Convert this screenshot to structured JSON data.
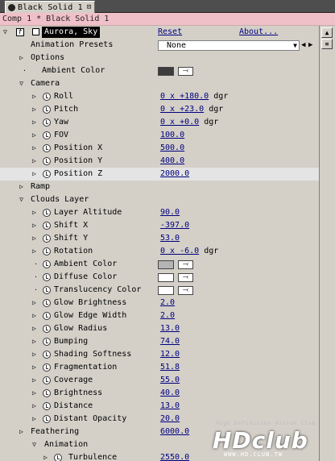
{
  "tab": {
    "label": "Black Solid 1",
    "pin": "⊡"
  },
  "comp_label": "Comp 1 * Black Solid 1",
  "effect": {
    "name": "Aurora, Sky",
    "reset_label": "Reset",
    "about_label": "About..."
  },
  "presets": {
    "label": "Animation Presets",
    "value": "None"
  },
  "colors": {
    "ambient_top": "#3c3c3c",
    "ambient_clouds": "#b4b4b4",
    "diffuse": "#ffffff",
    "translucency": "#ffffff",
    "panel_bg": "#d4d0c8",
    "value_blue": "#000080"
  },
  "rows": [
    {
      "kind": "group",
      "indent": 0,
      "open": false,
      "label": "Options"
    },
    {
      "kind": "color",
      "indent": 0,
      "label": "Ambient Color",
      "color": "#3c3c3c"
    },
    {
      "kind": "group",
      "indent": 0,
      "open": true,
      "label": "Camera"
    },
    {
      "kind": "prop",
      "label": "Roll",
      "num": "0 x +180.0",
      "unit": " dgr"
    },
    {
      "kind": "prop",
      "label": "Pitch",
      "num": "0 x +23.0",
      "unit": " dgr"
    },
    {
      "kind": "prop",
      "label": "Yaw",
      "num": "0 x +0.0",
      "unit": " dgr"
    },
    {
      "kind": "prop",
      "label": "FOV",
      "num": "100.0",
      "unit": ""
    },
    {
      "kind": "prop",
      "label": "Position X",
      "num": "500.0",
      "unit": ""
    },
    {
      "kind": "prop",
      "label": "Position Y",
      "num": "400.0",
      "unit": ""
    },
    {
      "kind": "prop",
      "label": "Position Z",
      "num": "2000.0",
      "unit": "",
      "highlight": true
    },
    {
      "kind": "group",
      "indent": 0,
      "open": false,
      "label": "Ramp"
    },
    {
      "kind": "group",
      "indent": 0,
      "open": true,
      "label": "Clouds Layer"
    },
    {
      "kind": "prop",
      "label": "Layer Altitude",
      "num": "90.0",
      "unit": ""
    },
    {
      "kind": "prop",
      "label": "Shift X",
      "num": "-397.0",
      "unit": ""
    },
    {
      "kind": "prop",
      "label": "Shift Y",
      "num": "53.0",
      "unit": ""
    },
    {
      "kind": "prop",
      "label": "Rotation",
      "num": "0 x -6.0",
      "unit": " dgr"
    },
    {
      "kind": "color",
      "indent": 1,
      "label": "Ambient Color",
      "color": "#b4b4b4"
    },
    {
      "kind": "color",
      "indent": 1,
      "label": "Diffuse Color",
      "color": "#ffffff"
    },
    {
      "kind": "color",
      "indent": 1,
      "label": "Translucency Color",
      "color": "#ffffff"
    },
    {
      "kind": "prop",
      "label": "Glow Brightness",
      "num": "2.0",
      "unit": ""
    },
    {
      "kind": "prop",
      "label": "Glow Edge Width",
      "num": "2.0",
      "unit": ""
    },
    {
      "kind": "prop",
      "label": "Glow Radius",
      "num": "13.0",
      "unit": ""
    },
    {
      "kind": "prop",
      "label": "Bumping",
      "num": "74.0",
      "unit": ""
    },
    {
      "kind": "prop",
      "label": "Shading Softness",
      "num": "12.0",
      "unit": ""
    },
    {
      "kind": "prop",
      "label": "Fragmentation",
      "num": "51.8",
      "unit": ""
    },
    {
      "kind": "prop",
      "label": "Coverage",
      "num": "55.0",
      "unit": ""
    },
    {
      "kind": "prop",
      "label": "Brightness",
      "num": "40.0",
      "unit": ""
    },
    {
      "kind": "prop",
      "label": "Distance",
      "num": "13.0",
      "unit": ""
    },
    {
      "kind": "prop",
      "label": "Distant Opacity",
      "num": "20.0",
      "unit": ""
    },
    {
      "kind": "toppropclosed",
      "label": "Feathering",
      "num": "6000.0",
      "unit": ""
    },
    {
      "kind": "subgroup",
      "label": "Animation"
    },
    {
      "kind": "subprop",
      "label": "Turbulence",
      "num": "2550.0",
      "unit": ""
    }
  ],
  "watermark": {
    "top": "High Definition Vision Club",
    "logo": "HDclub",
    "url": "WWW.HD.CLUB.TW"
  }
}
